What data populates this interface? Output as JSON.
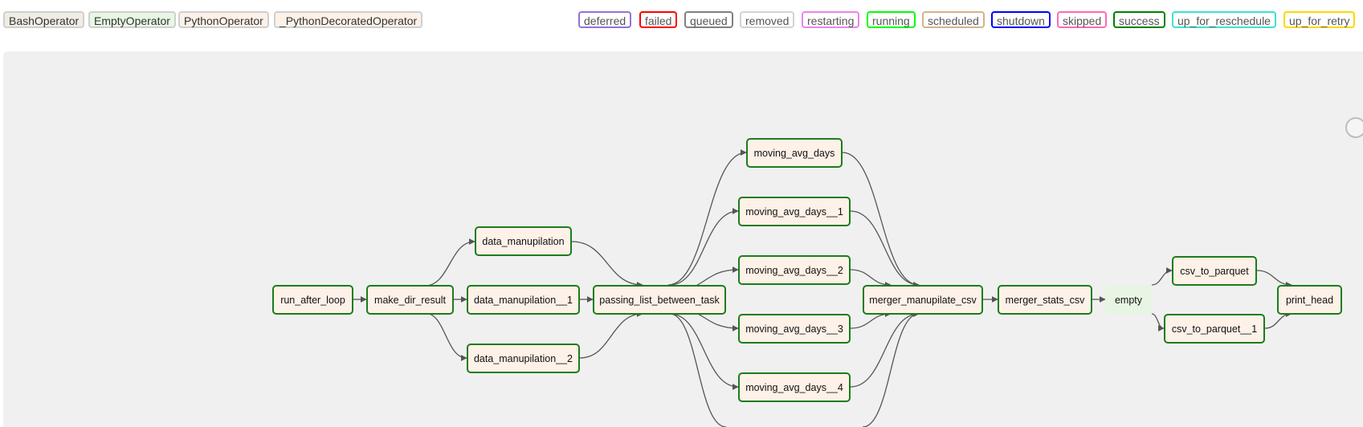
{
  "operators": [
    {
      "label": "BashOperator",
      "color": "#f0ede4"
    },
    {
      "label": "EmptyOperator",
      "color": "#e8f7e4"
    },
    {
      "label": "PythonOperator",
      "color": "#fdf1e8"
    },
    {
      "label": "_PythonDecoratedOperator",
      "color": "#fdf1e8"
    }
  ],
  "states": [
    {
      "label": "deferred",
      "color": "#9370db"
    },
    {
      "label": "failed",
      "color": "#ff0000"
    },
    {
      "label": "queued",
      "color": "#808080"
    },
    {
      "label": "removed",
      "color": "#d3d3d3"
    },
    {
      "label": "restarting",
      "color": "#ee82ee"
    },
    {
      "label": "running",
      "color": "#00ff00"
    },
    {
      "label": "scheduled",
      "color": "#d2b48c"
    },
    {
      "label": "shutdown",
      "color": "#0000ff"
    },
    {
      "label": "skipped",
      "color": "#ff69b4"
    },
    {
      "label": "success",
      "color": "#008000"
    },
    {
      "label": "up_for_reschedule",
      "color": "#40e0d0"
    },
    {
      "label": "up_for_retry",
      "color": "#ffd700"
    }
  ],
  "nodes": {
    "run_after_loop": "run_after_loop",
    "make_dir_result": "make_dir_result",
    "data_manupilation": "data_manupilation",
    "data_manupilation__1": "data_manupilation__1",
    "data_manupilation__2": "data_manupilation__2",
    "passing_list_between_task": "passing_list_between_task",
    "moving_avg_days": "moving_avg_days",
    "moving_avg_days__1": "moving_avg_days__1",
    "moving_avg_days__2": "moving_avg_days__2",
    "moving_avg_days__3": "moving_avg_days__3",
    "moving_avg_days__4": "moving_avg_days__4",
    "merger_manupilate_csv": "merger_manupilate_csv",
    "merger_stats_csv": "merger_stats_csv",
    "empty": "empty",
    "csv_to_parquet": "csv_to_parquet",
    "csv_to_parquet__1": "csv_to_parquet__1",
    "print_head": "print_head"
  },
  "task_states": {
    "all_tasks": "success"
  }
}
